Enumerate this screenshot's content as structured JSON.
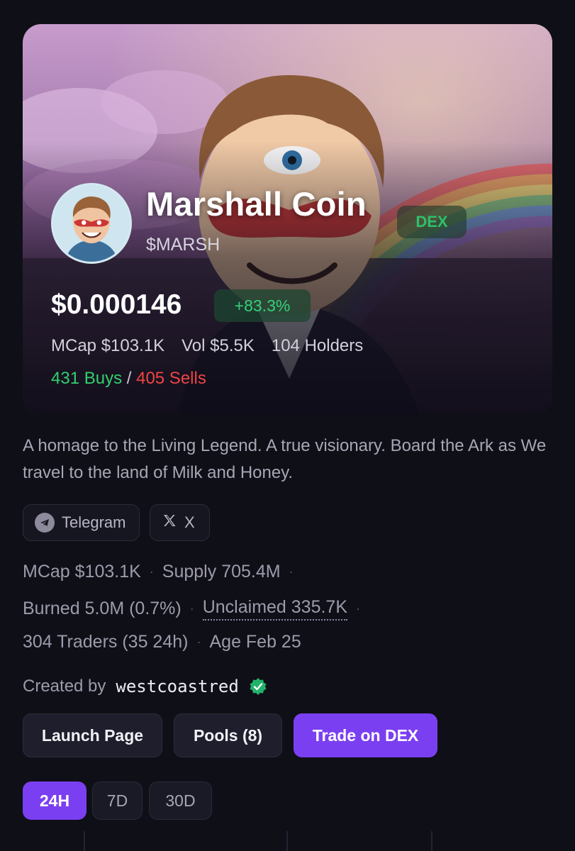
{
  "coin": {
    "name": "Marshall Coin",
    "ticker": "$MARSH",
    "market_badge": "DEX",
    "price": "$0.000146",
    "change": "+83.3%",
    "hero_stats": [
      "MCap $103.1K",
      "Vol $5.5K",
      "104 Holders"
    ],
    "buys": "431 Buys",
    "separator": "/",
    "sells": "405 Sells"
  },
  "description": "A homage to the Living Legend. A true visionary. Board the Ark as We travel to the land of Milk and Honey.",
  "socials": [
    {
      "label": "Telegram",
      "icon": "telegram-icon"
    },
    {
      "label": "X",
      "icon": "x-logo-icon"
    }
  ],
  "metrics": {
    "line1": [
      "MCap $103.1K",
      "Supply 705.4M"
    ],
    "line2": [
      "Burned 5.0M (0.7%)",
      "Unclaimed 335.7K"
    ],
    "line3": [
      "304 Traders (35 24h)",
      "Age Feb 25"
    ]
  },
  "creator": {
    "prefix": "Created by",
    "username": "westcoastred",
    "verified_icon": "verified-badge-icon"
  },
  "actions": {
    "launch_page": "Launch Page",
    "pools": "Pools (8)",
    "trade": "Trade on DEX"
  },
  "periods": {
    "selected": "24H",
    "items": [
      "24H",
      "7D",
      "30D"
    ]
  },
  "colors": {
    "accent": "#7b3ff2",
    "positive": "#32d06e",
    "negative": "#ef4444",
    "background": "#0f0f17"
  }
}
